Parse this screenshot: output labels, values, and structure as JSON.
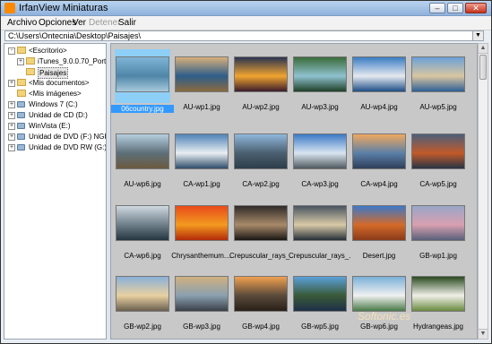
{
  "window": {
    "title": "IrfanView Miniaturas",
    "min": "–",
    "max": "□",
    "close": "✕"
  },
  "menu": [
    "Archivo",
    "Opciones",
    "Ver",
    "Detener",
    "Salir"
  ],
  "path": "C:\\Users\\Ontecnia\\Desktop\\Paisajes\\",
  "path_dropdown": "▼",
  "tree": [
    {
      "label": "<Escritorio>",
      "exp": "-",
      "kind": "folder"
    },
    {
      "label": "iTunes_9.0.0.70_Portable",
      "exp": "+",
      "kind": "folder"
    },
    {
      "label": "Paisajes",
      "exp": "",
      "kind": "folder",
      "selected": true
    },
    {
      "label": "<Mis documentos>",
      "exp": "+",
      "kind": "folder"
    },
    {
      "label": "<Mis imágenes>",
      "exp": "",
      "kind": "folder"
    },
    {
      "label": "Windows 7 (C:)",
      "exp": "+",
      "kind": "drive"
    },
    {
      "label": "Unidad de CD (D:)",
      "exp": "+",
      "kind": "drive"
    },
    {
      "label": "WinVista (E:)",
      "exp": "+",
      "kind": "drive"
    },
    {
      "label": "Unidad de DVD (F:) NGH14...",
      "exp": "+",
      "kind": "drive"
    },
    {
      "label": "Unidad de DVD RW (G:)",
      "exp": "+",
      "kind": "drive"
    }
  ],
  "thumbnails": [
    {
      "name": "06country.jpg",
      "colors": [
        "#7fb4d6",
        "#4f86a8",
        "#a7c9dc"
      ],
      "selected": true
    },
    {
      "name": "AU-wp1.jpg",
      "colors": [
        "#d7b07a",
        "#2e5d8a",
        "#8a6a3f"
      ]
    },
    {
      "name": "AU-wp2.jpg",
      "colors": [
        "#2a3350",
        "#f0a430",
        "#3a1d2c"
      ]
    },
    {
      "name": "AU-wp3.jpg",
      "colors": [
        "#3a6b3a",
        "#8fc1cf",
        "#1f4027"
      ]
    },
    {
      "name": "AU-wp4.jpg",
      "colors": [
        "#3a7cc3",
        "#e5e9f0",
        "#1e4f86"
      ]
    },
    {
      "name": "AU-wp5.jpg",
      "colors": [
        "#6ba0d8",
        "#d9c6a0",
        "#2e5f96"
      ]
    },
    {
      "name": "AU-wp6.jpg",
      "colors": [
        "#b7cfe0",
        "#5d6f78",
        "#6b5a3f"
      ]
    },
    {
      "name": "CA-wp1.jpg",
      "colors": [
        "#4f82b8",
        "#e9eef2",
        "#2f4d6b"
      ]
    },
    {
      "name": "CA-wp2.jpg",
      "colors": [
        "#8fb8dc",
        "#4a5f6f",
        "#2e3d4a"
      ]
    },
    {
      "name": "CA-wp3.jpg",
      "colors": [
        "#3b79c6",
        "#d9e5f0",
        "#505a60"
      ]
    },
    {
      "name": "CA-wp4.jpg",
      "colors": [
        "#f0a860",
        "#5a7fa8",
        "#2f3f5a"
      ]
    },
    {
      "name": "CA-wp5.jpg",
      "colors": [
        "#4a5f7a",
        "#c25a2a",
        "#273445"
      ]
    },
    {
      "name": "CA-wp6.jpg",
      "colors": [
        "#cfd8e0",
        "#6e7f8a",
        "#263640"
      ]
    },
    {
      "name": "Chrysanthemum....",
      "colors": [
        "#e84a1a",
        "#f39a20",
        "#b32a0a"
      ]
    },
    {
      "name": "Crepuscular_rays_...",
      "colors": [
        "#2f2a28",
        "#a88a6a",
        "#1a1614"
      ]
    },
    {
      "name": "Crepuscular_rays_...",
      "colors": [
        "#4a5560",
        "#d8c9a8",
        "#263038"
      ]
    },
    {
      "name": "Desert.jpg",
      "colors": [
        "#3c78c8",
        "#d46a2a",
        "#8a3a1a"
      ]
    },
    {
      "name": "GB-wp1.jpg",
      "colors": [
        "#9aa6c8",
        "#d8a0b0",
        "#58607a"
      ]
    },
    {
      "name": "GB-wp2.jpg",
      "colors": [
        "#8ab0d8",
        "#e8d0a0",
        "#6a6050"
      ]
    },
    {
      "name": "GB-wp3.jpg",
      "colors": [
        "#d0b080",
        "#8aa0b0",
        "#3a4048"
      ]
    },
    {
      "name": "GB-wp4.jpg",
      "colors": [
        "#f0a050",
        "#5a4a3a",
        "#2a2018"
      ]
    },
    {
      "name": "GB-wp5.jpg",
      "colors": [
        "#5aa0d8",
        "#3a5a38",
        "#1e3048"
      ]
    },
    {
      "name": "GB-wp6.jpg",
      "colors": [
        "#7ab0d8",
        "#f0f0f0",
        "#4a7a48"
      ]
    },
    {
      "name": "Hydrangeas.jpg",
      "colors": [
        "#2a4a20",
        "#f0f0e8",
        "#6a8a40"
      ]
    }
  ],
  "scroll": {
    "up": "▲",
    "down": "▼"
  },
  "watermark": "Softonic.es"
}
